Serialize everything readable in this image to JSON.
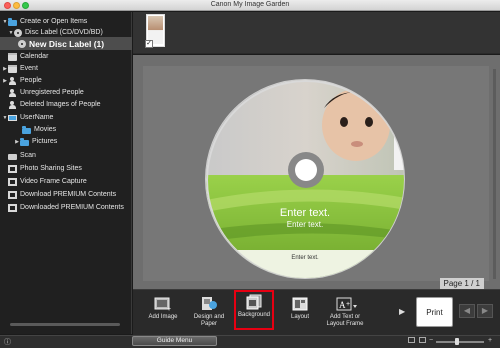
{
  "window": {
    "title": "Canon My Image Garden"
  },
  "sidebar": {
    "items": [
      {
        "label": "Create or Open Items",
        "arrow": "▼",
        "icon": "folder-icon"
      },
      {
        "label": "Disc Label (CD/DVD/BD)",
        "arrow": "▼",
        "icon": "disc-icon"
      },
      {
        "label": "New Disc Label (1)",
        "arrow": "",
        "icon": "disc-icon"
      },
      {
        "label": "Calendar",
        "arrow": "",
        "icon": "calendar-icon"
      },
      {
        "label": "Event",
        "arrow": "▶",
        "icon": "calendar-icon"
      },
      {
        "label": "People",
        "arrow": "▶",
        "icon": "person-icon"
      },
      {
        "label": "Unregistered People",
        "arrow": "",
        "icon": "person-icon"
      },
      {
        "label": "Deleted Images of People",
        "arrow": "",
        "icon": "person-icon"
      },
      {
        "label": "UserName",
        "arrow": "▼",
        "icon": "monitor-icon"
      },
      {
        "label": "Movies",
        "arrow": "",
        "icon": "folder-icon"
      },
      {
        "label": "Pictures",
        "arrow": "▶",
        "icon": "folder-icon"
      },
      {
        "label": "Scan",
        "arrow": "",
        "icon": "scan-icon"
      },
      {
        "label": "Photo Sharing Sites",
        "arrow": "",
        "icon": "photo-sharing-icon"
      },
      {
        "label": "Video Frame Capture",
        "arrow": "",
        "icon": "film-icon"
      },
      {
        "label": "Download PREMIUM Contents",
        "arrow": "",
        "icon": "download-icon"
      },
      {
        "label": "Downloaded PREMIUM Contents",
        "arrow": "",
        "icon": "download-icon"
      }
    ]
  },
  "canvas": {
    "page_label": "Page 1 / 1",
    "disc_text_large": "Enter text.",
    "disc_text_medium": "Enter text.",
    "disc_text_small": "Enter text."
  },
  "toolbar": {
    "tools": [
      {
        "label": "Add Image",
        "icon": "add-image-icon"
      },
      {
        "label": "Design and Paper",
        "icon": "design-paper-icon"
      },
      {
        "label": "Background",
        "icon": "background-icon"
      },
      {
        "label": "Layout",
        "icon": "layout-icon"
      },
      {
        "label": "Add Text or Layout Frame",
        "icon": "add-text-icon"
      }
    ],
    "print_label": "Print",
    "prev_symbol": "◀",
    "next_symbol": "▶",
    "more_symbol": "▶"
  },
  "statusbar": {
    "guide_menu_label": "Guide Menu",
    "info_symbol": "ⓘ",
    "zoom_minus": "−",
    "zoom_plus": "+"
  },
  "colors": {
    "highlight": "#e60012",
    "disc_green": "#8cc63f",
    "folder_blue": "#4aa3df"
  }
}
